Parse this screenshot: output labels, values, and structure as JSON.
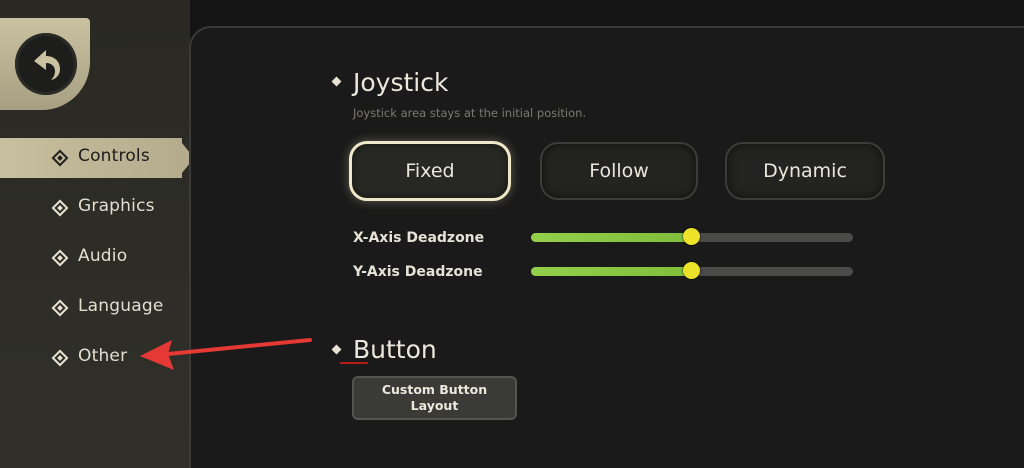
{
  "sidebar": {
    "back_icon": "back-arrow-icon",
    "items": [
      {
        "label": "Controls",
        "active": true
      },
      {
        "label": "Graphics",
        "active": false
      },
      {
        "label": "Audio",
        "active": false
      },
      {
        "label": "Language",
        "active": false
      },
      {
        "label": "Other",
        "active": false
      }
    ]
  },
  "joystick": {
    "title": "Joystick",
    "description": "Joystick area stays at the initial position.",
    "modes": [
      {
        "label": "Fixed",
        "selected": true
      },
      {
        "label": "Follow",
        "selected": false
      },
      {
        "label": "Dynamic",
        "selected": false
      }
    ],
    "sliders": [
      {
        "label": "X-Axis Deadzone",
        "value": 0.5
      },
      {
        "label": "Y-Axis Deadzone",
        "value": 0.5
      }
    ]
  },
  "button_section": {
    "title": "Button",
    "custom_button_line1": "Custom Button",
    "custom_button_line2": "Layout"
  },
  "colors": {
    "accent_tan": "#c7bf9e",
    "slider_fill": "#8cc943",
    "slider_thumb": "#ece229",
    "annotation_red": "#e53935"
  }
}
